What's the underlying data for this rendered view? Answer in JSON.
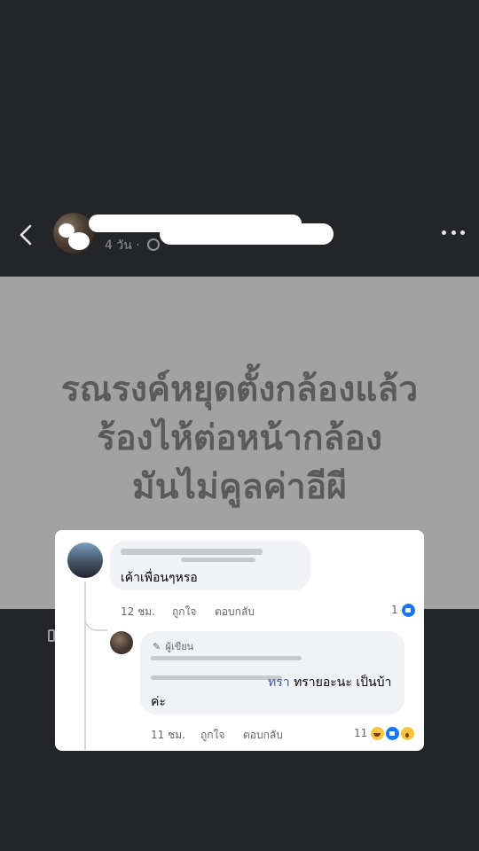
{
  "post": {
    "meta": "4 วัน ·",
    "icons": {
      "back": "chevron-left-icon",
      "privacy": "globe-icon",
      "more": "more-dots-icon"
    }
  },
  "image": {
    "caption_lines": [
      "รณรงค์หยุดตั้งกล้องแล้ว",
      "ร้องไห้ต่อหน้ากล้อง",
      "มันไม่คูลค่าอีผี"
    ],
    "background": "#a2a2a2",
    "text_color": "#5a5a5a"
  },
  "comments": [
    {
      "text": "เค้าเพื่อนๆหรอ",
      "time": "12 ชม.",
      "like_label": "ถูกใจ",
      "reply_label": "ตอบกลับ",
      "reaction_count": "1",
      "reactions": [
        "like-icon"
      ]
    },
    {
      "author_badge": "ผู้เขียน",
      "mention_tail": "ทรา",
      "text": "ทรายอะนะ เป็นบ้า\nค่ะ",
      "time": "11 ชม.",
      "like_label": "ถูกใจ",
      "reply_label": "ตอบกลับ",
      "reaction_count": "11",
      "reactions": [
        "haha-icon",
        "like-icon",
        "wow-icon"
      ]
    }
  ],
  "colors": {
    "app_background": "#242529",
    "card_background": "#ffffff",
    "bubble_background": "#f0f2f5",
    "like_blue": "#1877f2",
    "mention_blue": "#385898"
  }
}
